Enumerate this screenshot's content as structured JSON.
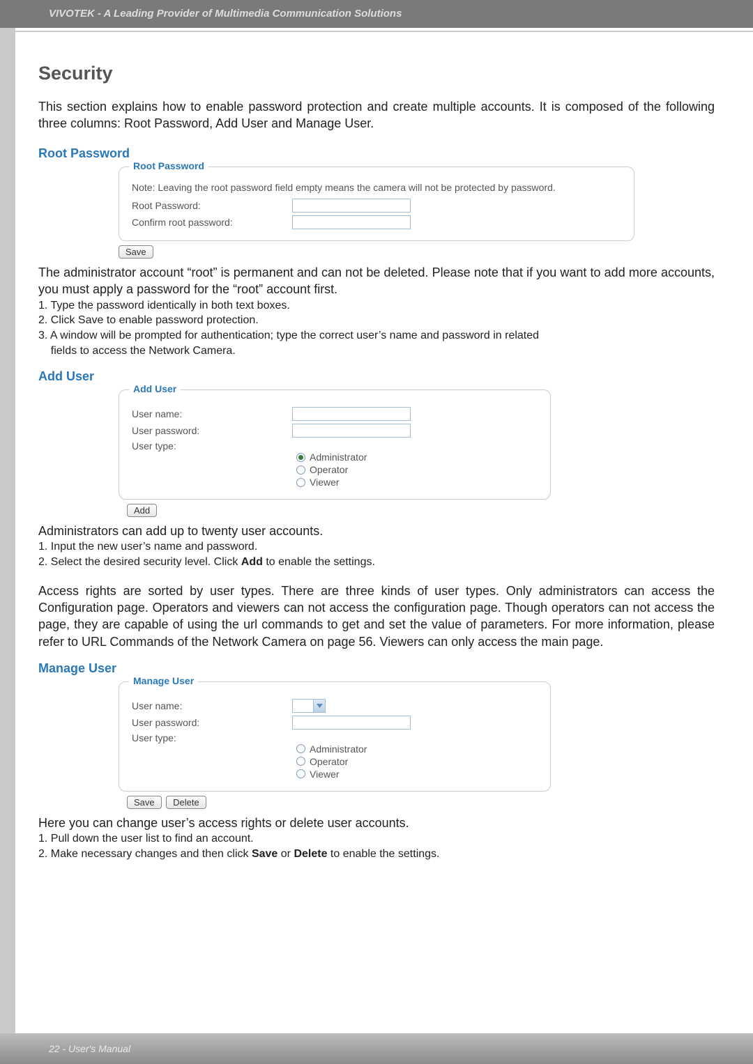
{
  "header": {
    "brand_text": "VIVOTEK - A Leading Provider of Multimedia Communication Solutions"
  },
  "page": {
    "title": "Security",
    "intro": "This section explains how to enable password protection and create multiple accounts. It is composed of the following three columns: Root Password, Add User and Manage User."
  },
  "root_password": {
    "section_title": "Root Password",
    "legend": "Root Password",
    "note": "Note: Leaving the root password field empty means the camera will not be protected by password.",
    "label_root": "Root Password:",
    "label_confirm": "Confirm root password:",
    "value_root": "",
    "value_confirm": "",
    "save_btn": "Save",
    "after_text_1": "The administrator account “root” is permanent and can not be deleted. Please note that if you want to add more accounts, you must apply a password for the “root” account first.",
    "steps": [
      "1. Type the password identically in both text boxes.",
      "2. Click Save to enable password protection.",
      "3. A window will be prompted for authentication; type the correct user’s name and password in related",
      "    fields to access the Network Camera."
    ]
  },
  "add_user": {
    "section_title": "Add User",
    "legend": "Add User",
    "label_name": "User name:",
    "label_pw": "User password:",
    "label_type": "User type:",
    "value_name": "",
    "value_pw": "",
    "radios": {
      "admin": "Administrator",
      "operator": "Operator",
      "viewer": "Viewer"
    },
    "add_btn": "Add",
    "desc_line": "Administrators can add up to twenty user accounts.",
    "steps": [
      "1. Input the new user’s name and password.",
      "2. Select the desired security level. Click "
    ],
    "step2_bold": "Add",
    "step2_tail": " to enable the settings.",
    "access_rights": "Access rights are sorted by user types. There are three kinds of user types. Only administrators can access the Configuration page. Operators and viewers can not access the configuration page. Though operators can not access the page, they are capable of using the url commands to get and set the value of parameters. For more information, please refer to URL Commands of the Network Camera on page 56. Viewers can only access the main page."
  },
  "manage_user": {
    "section_title": "Manage User",
    "legend": "Manage User",
    "label_name": "User name:",
    "label_pw": "User password:",
    "label_type": "User type:",
    "value_pw": "",
    "select_value": "",
    "radios": {
      "admin": "Administrator",
      "operator": "Operator",
      "viewer": "Viewer"
    },
    "save_btn": "Save",
    "delete_btn": "Delete",
    "desc_line": "Here you can change user’s access rights or delete user accounts.",
    "steps_1": "1. Pull down the user list to find an account.",
    "steps_2_pre": "2. Make necessary changes and then click ",
    "steps_2_b1": "Save",
    "steps_2_mid": " or ",
    "steps_2_b2": "Delete",
    "steps_2_tail": " to enable the settings."
  },
  "footer": {
    "text": "22 - User's Manual"
  }
}
